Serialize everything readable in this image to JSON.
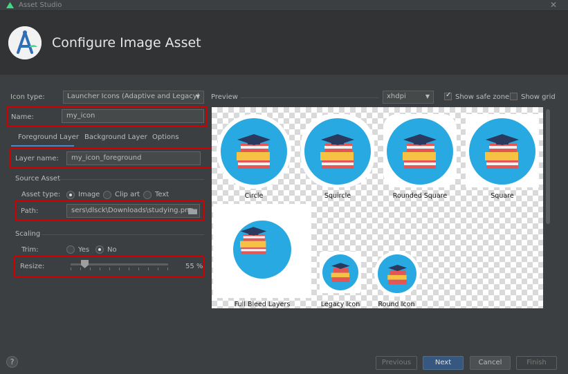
{
  "window": {
    "title": "Asset Studio"
  },
  "header": {
    "title": "Configure Image Asset"
  },
  "form": {
    "icon_type_label": "Icon type:",
    "icon_type_value": "Launcher Icons (Adaptive and Legacy)",
    "name_label": "Name:",
    "name_value": "my_icon",
    "tabs": [
      "Foreground Layer",
      "Background Layer",
      "Options"
    ],
    "layer_name_label": "Layer name:",
    "layer_name_value": "my_icon_foreground",
    "source_asset_label": "Source Asset",
    "asset_type_label": "Asset type:",
    "asset_type_options": [
      "Image",
      "Clip art",
      "Text"
    ],
    "asset_type_selected": "Image",
    "path_label": "Path:",
    "path_value": "sers\\dlsck\\Downloads\\studying.png",
    "scaling_label": "Scaling",
    "trim_label": "Trim:",
    "trim_options": [
      "Yes",
      "No"
    ],
    "trim_selected": "No",
    "resize_label": "Resize:",
    "resize_value": "55 %",
    "resize_percent": 55
  },
  "preview": {
    "label": "Preview",
    "density": "xhdpi",
    "show_safe_zone_label": "Show safe zone",
    "show_safe_zone_checked": true,
    "show_grid_label": "Show grid",
    "show_grid_checked": false,
    "captions": [
      "Circle",
      "Squircle",
      "Rounded Square",
      "Square",
      "Full Bleed Layers",
      "Legacy Icon",
      "Round Icon"
    ]
  },
  "footer": {
    "help": "?",
    "previous": "Previous",
    "next": "Next",
    "cancel": "Cancel",
    "finish": "Finish"
  },
  "colors": {
    "accent_red": "#d40000",
    "icon_blue": "#29a9e1",
    "next_button": "#365880"
  }
}
